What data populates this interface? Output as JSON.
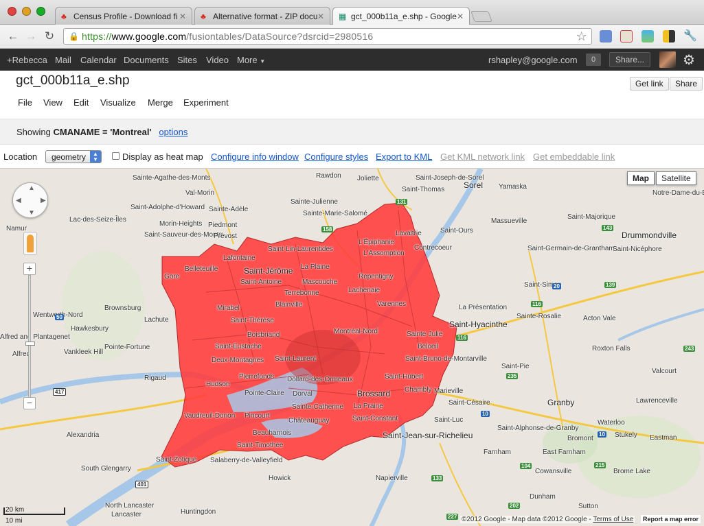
{
  "browser": {
    "tabs": [
      {
        "label": "Census Profile - Download fi",
        "icon": "maple-leaf-icon"
      },
      {
        "label": "Alternative format - ZIP docu",
        "icon": "maple-leaf-icon"
      },
      {
        "label": "gct_000b11a_e.shp - Google",
        "icon": "fusion-tables-icon"
      }
    ],
    "url": {
      "protocol": "https://",
      "host": "www.google.com",
      "path": "/fusiontables/DataSource?dsrcid=2980516"
    }
  },
  "gbar": {
    "links": [
      "+Rebecca",
      "Mail",
      "Calendar",
      "Documents",
      "Sites",
      "Video",
      "More"
    ],
    "user_email": "rshapley@google.com",
    "notification_count": "0",
    "share_label": "Share..."
  },
  "page": {
    "title": "gct_000b11a_e.shp",
    "get_link_label": "Get link",
    "share_label": "Share",
    "menu": [
      "File",
      "View",
      "Edit",
      "Visualize",
      "Merge",
      "Experiment"
    ],
    "filter": {
      "prefix": "Showing",
      "condition": "CMANAME = 'Montreal'",
      "options_link": "options"
    },
    "map_options": {
      "location_label": "Location",
      "location_value": "geometry",
      "heatmap_label": "Display as heat map",
      "links": [
        "Configure info window",
        "Configure styles",
        "Export to KML"
      ],
      "disabled_links": [
        "Get KML network link",
        "Get embeddable link"
      ]
    }
  },
  "map": {
    "type_buttons": [
      "Map",
      "Satellite"
    ],
    "selected_type": "Map",
    "scale": {
      "km": "20 km",
      "mi": "10 mi"
    },
    "attribution": "©2012 Google - Map data ©2012 Google -",
    "terms_label": "Terms of Use",
    "report_label": "Report a map error",
    "overlay_color": "#ff3b3b",
    "places": [
      "Sainte-Agathe-des-Monts",
      "Rawdon",
      "Joliette",
      "Saint-Joseph-de-Sorel",
      "Sorel",
      "Yamaska",
      "Notre-Dame-du-B",
      "Val-Morin",
      "Saint-Thomas",
      "Saint-Adolphe-d'Howard",
      "Sainte-Adèle",
      "Sainte-Julienne",
      "Sainte-Marie-Salomé",
      "Saint-Majorique",
      "Lac-des-Seize-Îles",
      "Morin-Heights",
      "Piedmont",
      "Massueville",
      "Saint-Ours",
      "Namur",
      "Saint-Sauveur-des-Monts",
      "Prévost",
      "Lavaltrie",
      "Drummondville",
      "L'Épiphanie",
      "L'Assomption",
      "Contrecoeur",
      "Saint-Germain-de-Grantham",
      "Saint-Nicéphore",
      "Saint-Lin-Laurentides",
      "Lafontaine",
      "Belleteuille",
      "Saint-Jérôme",
      "La Plaine",
      "Repentigny",
      "Saint-Antoine",
      "Mascouche",
      "Saint-Simon",
      "Gore",
      "Terrebonne",
      "Lachenaie",
      "Brownsburg",
      "Mirabel",
      "Blainville",
      "Varennes",
      "La Présentation",
      "Lachute",
      "Saint-Thérèse",
      "Saint-Hyacinthe",
      "Sainte-Rosalie",
      "Acton Vale",
      "Hawkesbury",
      "Boisbriand",
      "Montréal-Nord",
      "Sainte-Julie",
      "Saint-Eustache",
      "Beloeil",
      "Alfred and Plantagenet",
      "Pointe-Fortune",
      "Wentworth-Nord",
      "Saint-Bruno-de-Montarville",
      "Roxton Falls",
      "Alfred",
      "Vankleek Hill",
      "Deux-Montagnes",
      "Saint-Laurent",
      "Saint-Pie",
      "Rigaud",
      "Pierrefonds",
      "Saint-Hubert",
      "Valcourt",
      "Hudson",
      "Dollard-des-Ormeaux",
      "Chambly",
      "Marieville",
      "Pointe-Claire",
      "Dorval",
      "Brossard",
      "Granby",
      "Lawrenceville",
      "Sainte-Catherine",
      "La Prairie",
      "Saint-Césaire",
      "Vaudreuil-Dorion",
      "Pincourt",
      "Saint-Constant",
      "Saint-Luc",
      "Waterloo",
      "Alexandria",
      "Châteauguay",
      "Saint-Alphonse-de-Granby",
      "Bromont",
      "Stukely",
      "Eastman",
      "Beauharnois",
      "Saint-Jean-sur-Richelieu",
      "Saint-Timothée",
      "Farnham",
      "East Farnham",
      "Saint-Zotique",
      "Salaberry-de-Valleyfield",
      "Cowansville",
      "Brome Lake",
      "South Glengarry",
      "Howick",
      "Napierville",
      "Dunham",
      "North Lancaster",
      "Huntingdon",
      "Sutton",
      "Lancaster"
    ]
  }
}
